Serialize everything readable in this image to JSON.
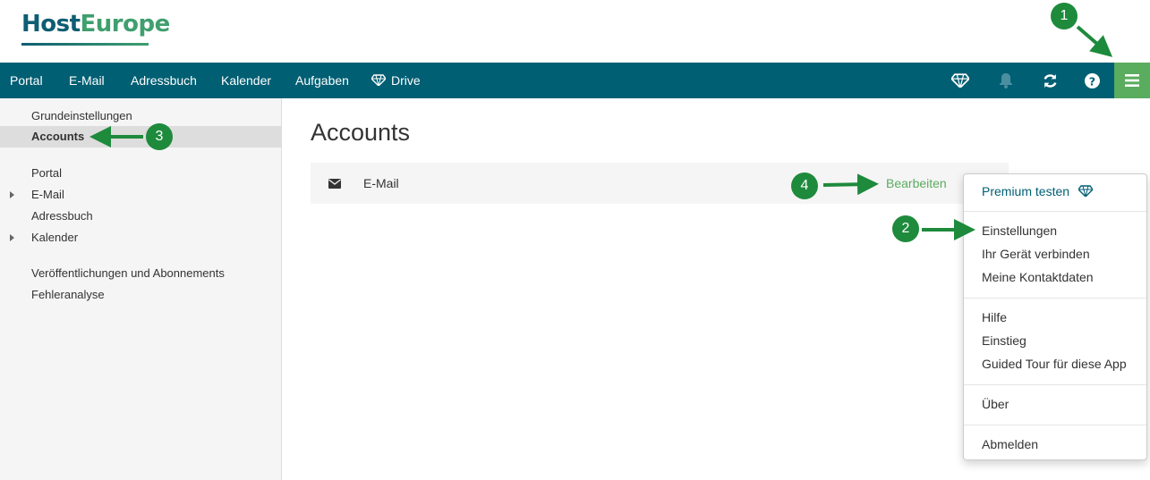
{
  "brand": {
    "logo_text_main": "Host",
    "logo_text_accent": "Europe"
  },
  "topnav": {
    "items": [
      "Portal",
      "E-Mail",
      "Adressbuch",
      "Kalender",
      "Aufgaben",
      "Drive"
    ],
    "right_icons": [
      "diamond-icon",
      "bell-icon",
      "refresh-icon",
      "help-icon",
      "menu-icon"
    ]
  },
  "sidebar": {
    "items": [
      {
        "label": "Grundeinstellungen",
        "active": false
      },
      {
        "label": "Accounts",
        "active": true
      },
      {
        "label": "Portal",
        "active": false
      },
      {
        "label": "E-Mail",
        "active": false,
        "expandable": true
      },
      {
        "label": "Adressbuch",
        "active": false
      },
      {
        "label": "Kalender",
        "active": false,
        "expandable": true
      },
      {
        "label": "Veröffentlichungen und Abonnements",
        "active": false
      },
      {
        "label": "Fehleranalyse",
        "active": false
      }
    ]
  },
  "main": {
    "title": "Accounts",
    "account": {
      "label": "E-Mail",
      "action": "Bearbeiten",
      "icon": "envelope-icon"
    }
  },
  "dropdown": {
    "premium": "Premium testen",
    "items": [
      "Einstellungen",
      "Ihr Gerät verbinden",
      "Meine Kontaktdaten",
      "Hilfe",
      "Einstieg",
      "Guided Tour für diese App",
      "Über",
      "Abmelden"
    ]
  },
  "annotations": {
    "badges": [
      "1",
      "2",
      "3",
      "4"
    ]
  },
  "colors": {
    "nav": "#005f73",
    "accent": "#5aac5e",
    "badge": "#1e8a3c"
  }
}
